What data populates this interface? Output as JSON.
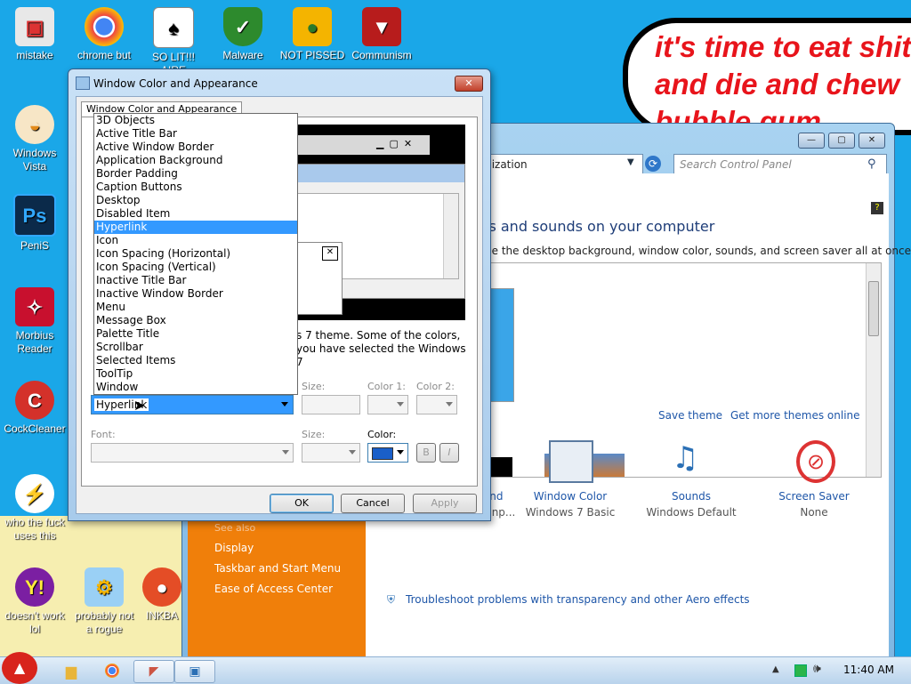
{
  "desktop_icons": [
    {
      "label": "mistake"
    },
    {
      "label": "chrome but"
    },
    {
      "label": "SO LIT!!! AIRE"
    },
    {
      "label": "Malware"
    },
    {
      "label": "NOT PISSED"
    },
    {
      "label": "Communism"
    },
    {
      "label": "Windows Vista"
    },
    {
      "label": "PeniS"
    },
    {
      "label": "Morbius Reader"
    },
    {
      "label": "CockCleaner"
    },
    {
      "label": "who the fuck uses this"
    },
    {
      "label": "doesn't work lol"
    },
    {
      "label": "probably not a rogue"
    },
    {
      "label": "INKBA"
    }
  ],
  "bubble": {
    "line1": "it's time to eat shit",
    "line2": "and die and chew",
    "line3": "bubble gum"
  },
  "control_panel": {
    "address": "alization",
    "search_placeholder": "Search Control Panel",
    "heading": "ls and sounds on your computer",
    "subheading": "ge the desktop background, window color, sounds, and screen saver all at once.",
    "save_theme": "Save theme",
    "get_more": "Get more themes online",
    "sidebar": [
      "Display",
      "Taskbar and Start Menu",
      "Ease of Access Center"
    ],
    "sidebar_see_also": "See also",
    "items": [
      {
        "title": "Desktop Background",
        "sub": "andimalloutofdolphinp..."
      },
      {
        "title": "Window Color",
        "sub": "Windows 7 Basic"
      },
      {
        "title": "Sounds",
        "sub": "Windows Default"
      },
      {
        "title": "Screen Saver",
        "sub": "None"
      }
    ],
    "troubleshoot": "Troubleshoot problems with transparency and other Aero effects"
  },
  "dialog": {
    "title": "Window Color and Appearance",
    "tab": "Window Color and Appearance",
    "info_line1": "s 7 theme.  Some of the colors,",
    "info_line2": "you have selected the Windows 7",
    "item_label": "Hyperlink",
    "size_label": "Size:",
    "color1_label": "Color 1:",
    "color2_label": "Color 2:",
    "font_label": "Font:",
    "font_size_label": "Size:",
    "color_label": "Color:",
    "bold": "B",
    "italic": "I",
    "ok": "OK",
    "cancel": "Cancel",
    "apply": "Apply",
    "selected_color": "#1a5fc9"
  },
  "dropdown_items": [
    "3D Objects",
    "Active Title Bar",
    "Active Window Border",
    "Application Background",
    "Border Padding",
    "Caption Buttons",
    "Desktop",
    "Disabled Item",
    "Hyperlink",
    "Icon",
    "Icon Spacing (Horizontal)",
    "Icon Spacing (Vertical)",
    "Inactive Title Bar",
    "Inactive Window Border",
    "Menu",
    "Message Box",
    "Palette Title",
    "Scrollbar",
    "Selected Items",
    "ToolTip",
    "Window"
  ],
  "dropdown_selected_index": 8,
  "taskbar": {
    "time": "11:40 AM"
  }
}
